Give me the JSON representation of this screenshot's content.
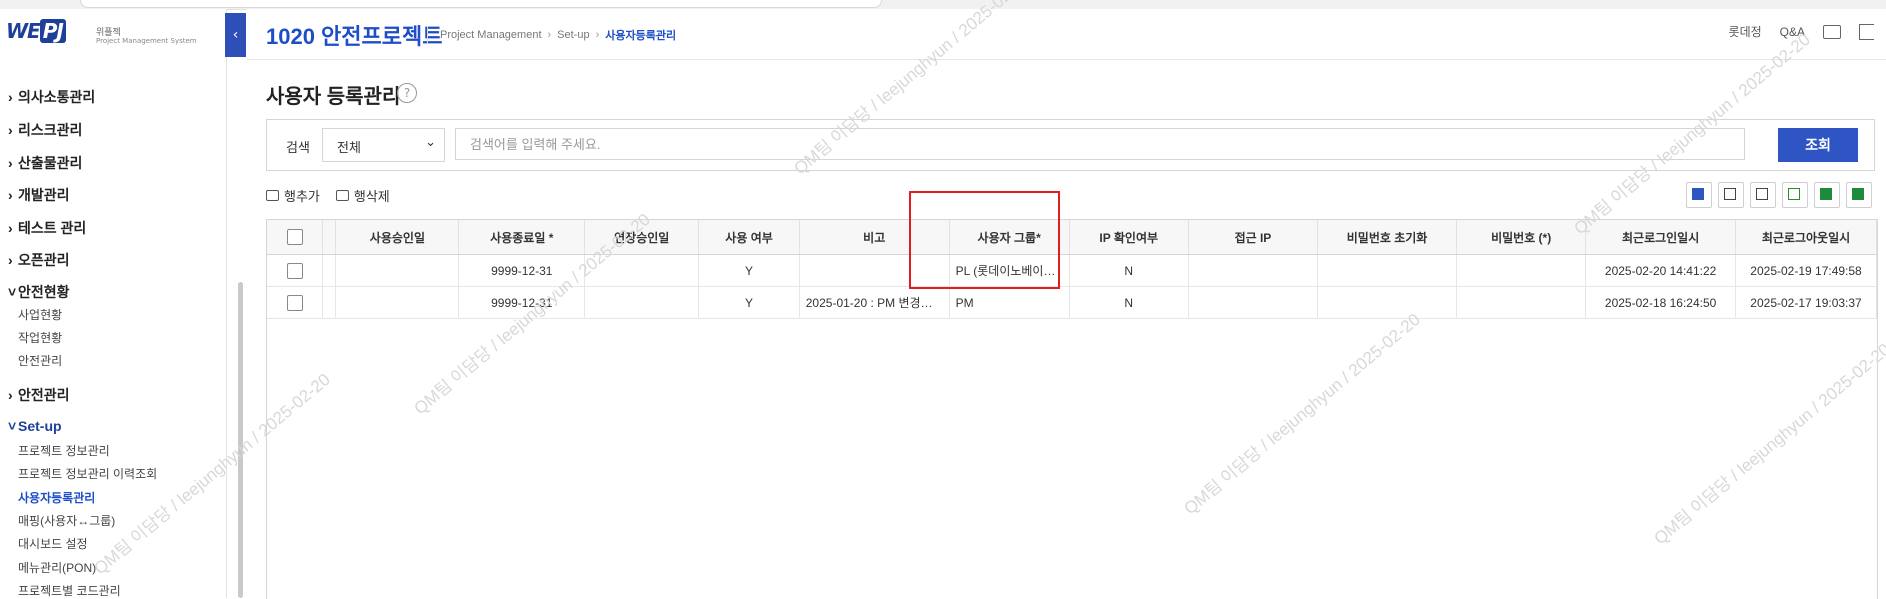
{
  "logo": {
    "text_we": "WE",
    "text_pj": "PJ",
    "brand_ko": "위플젝",
    "brand_en": "Project Management System"
  },
  "sidebar": {
    "sections": [
      {
        "label": "의사소통관리"
      },
      {
        "label": "리스크관리"
      },
      {
        "label": "산출물관리"
      },
      {
        "label": "개발관리"
      },
      {
        "label": "테스트 관리"
      },
      {
        "label": "오픈관리"
      },
      {
        "label": "안전현황"
      },
      {
        "label": "안전관리"
      },
      {
        "label": "Set-up"
      }
    ],
    "safety_status_items": [
      "사업현황",
      "작업현황",
      "안전관리"
    ],
    "setup_items": [
      "프로젝트 정보관리",
      "프로젝트 정보관리 이력조회",
      "사용자등록관리",
      "매핑(사용자↔그룹)",
      "대시보드 설정",
      "메뉴관리(PON)",
      "프로젝트별 코드관리"
    ]
  },
  "header": {
    "project_title": "1020 안전프로젝트",
    "breadcrumb": [
      "Project Management",
      "Set-up",
      "사용자등록관리"
    ],
    "user_name": "롯데정",
    "qa_label": "Q&A"
  },
  "page": {
    "title": "사용자 등록관리"
  },
  "search": {
    "label": "검색",
    "scope_selected": "전체",
    "placeholder": "검색어를 입력해 주세요.",
    "button_label": "조회"
  },
  "actions": {
    "add_row": "행추가",
    "delete_row": "행삭제"
  },
  "table": {
    "columns": [
      "사용승인일",
      "사용종료일 *",
      "연장승인일",
      "사용 여부",
      "비고",
      "사용자 그룹*",
      "IP 확인여부",
      "접근 IP",
      "비밀번호 초기화",
      "비밀번호 (*)",
      "최근로그인일시",
      "최근로그아웃일시"
    ],
    "rows": [
      {
        "approval": "",
        "end_date": "9999-12-31",
        "ext_date": "",
        "use_yn": "Y",
        "note": "",
        "group": "PL (롯데이노베이…",
        "ip_check": "N",
        "access_ip": "",
        "pw_reset": "",
        "pw": "",
        "last_login": "2025-02-20 14:41:22",
        "last_logout": "2025-02-19 17:49:58"
      },
      {
        "approval": "",
        "end_date": "9999-12-31",
        "ext_date": "",
        "use_yn": "Y",
        "note": "2025-01-20 : PM 변경…",
        "group": "PM",
        "ip_check": "N",
        "access_ip": "",
        "pw_reset": "",
        "pw": "",
        "last_login": "2025-02-18 16:24:50",
        "last_logout": "2025-02-17 19:03:37"
      }
    ]
  },
  "watermark": "QM팀 이담당 / leejunghyun / 2025-02-20",
  "colors": {
    "accent": "#1e4dc8",
    "button": "#2f55c4",
    "highlight": "#e01e1e"
  }
}
